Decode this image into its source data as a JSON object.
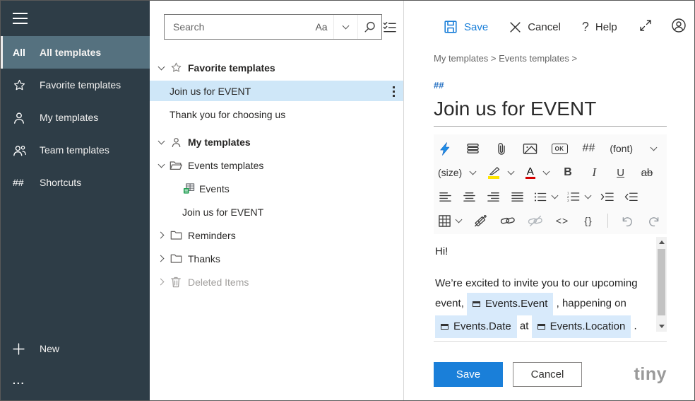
{
  "colors": {
    "accent": "#1a7fd9",
    "sidebar_bg": "#2e3d47",
    "sidebar_active_bg": "#55717f",
    "list_selection_bg": "#cfe7f8",
    "chip_bg": "#d8eafb",
    "link_blue": "#2570c2",
    "highlight_yellow": "#ffe400",
    "fontcolor_red": "#d40000"
  },
  "sidebar": {
    "items": [
      {
        "icon_text": "All",
        "label": "All templates"
      },
      {
        "label": "Favorite templates"
      },
      {
        "label": "My templates"
      },
      {
        "label": "Team templates"
      },
      {
        "icon_text": "##",
        "label": "Shortcuts"
      }
    ],
    "new_label": "New",
    "more_label": "..."
  },
  "search": {
    "placeholder": "Search",
    "case_label": "Aa"
  },
  "tree": {
    "favorites_header": "Favorite templates",
    "fav_item_selected": "Join us for EVENT",
    "fav_item_2": "Thank you for choosing us",
    "my_templates_header": "My templates",
    "events_folder": "Events templates",
    "events_sheet": "Events",
    "events_item": "Join us for EVENT",
    "reminders_folder": "Reminders",
    "thanks_folder": "Thanks",
    "deleted_folder": "Deleted Items"
  },
  "topbar": {
    "save": "Save",
    "cancel": "Cancel",
    "help": "Help",
    "help_icon": "?"
  },
  "breadcrumb": "My templates > Events templates >",
  "shortcut_link": "##",
  "template": {
    "title": "Join us for EVENT"
  },
  "toolbar": {
    "font_label": "(font)",
    "size_label": "(size)",
    "bold": "B",
    "italic": "I",
    "underline": "U",
    "strikethrough": "ab",
    "fontcolor_letter": "A",
    "ok_button": "OK",
    "shortcut": "##",
    "code": "<>",
    "braces": "{}"
  },
  "content": {
    "greeting": "Hi!",
    "line1": "We’re excited to invite you to our upcoming event,",
    "chip_event": "Events.Event",
    "line2": ", happening on",
    "chip_date": "Events.Date",
    "line3": "at",
    "chip_location": "Events.Location",
    "line4": "."
  },
  "footer": {
    "save": "Save",
    "cancel": "Cancel",
    "brand": "tiny"
  }
}
